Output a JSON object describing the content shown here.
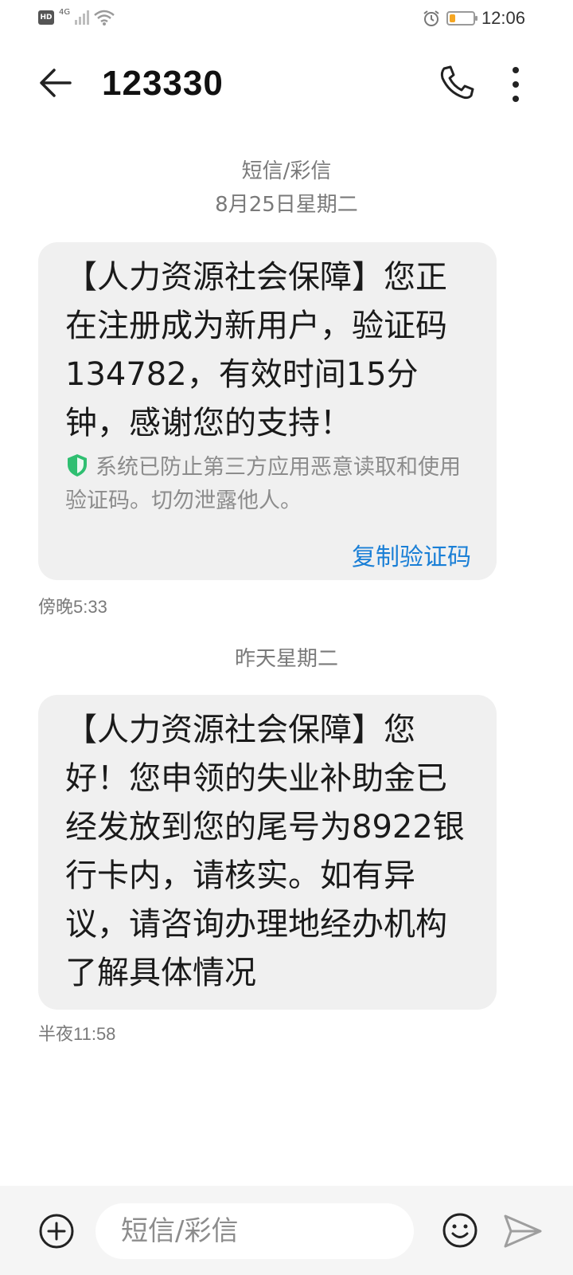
{
  "status_bar": {
    "hd_label": "HD",
    "network": "4G",
    "time": "12:06",
    "battery_color": "#f5a623"
  },
  "header": {
    "title": "123330",
    "back_icon": "back-arrow-icon",
    "call_icon": "phone-icon",
    "more_icon": "more-vertical-icon"
  },
  "conversation": {
    "channel_label": "短信/彩信",
    "messages": [
      {
        "date": "8月25日星期二",
        "text": "【人力资源社会保障】您正在注册成为新用户，验证码134782，有效时间15分钟，感谢您的支持！",
        "security_note": "系统已防止第三方应用恶意读取和使用验证码。切勿泄露他人。",
        "action_label": "复制验证码",
        "time": "傍晚5:33"
      },
      {
        "date": "昨天星期二",
        "text": "【人力资源社会保障】您好！您申领的失业补助金已经发放到您的尾号为8922银行卡内，请核实。如有异议，请咨询办理地经办机构了解具体情况",
        "time": "半夜11:58"
      }
    ]
  },
  "input_bar": {
    "placeholder": "短信/彩信",
    "add_icon": "plus-circle-icon",
    "emoji_icon": "emoji-icon",
    "send_icon": "send-icon"
  },
  "colors": {
    "accent": "#1a7fd6",
    "bubble": "#f0f0f0",
    "shield": "#2fbf71"
  }
}
